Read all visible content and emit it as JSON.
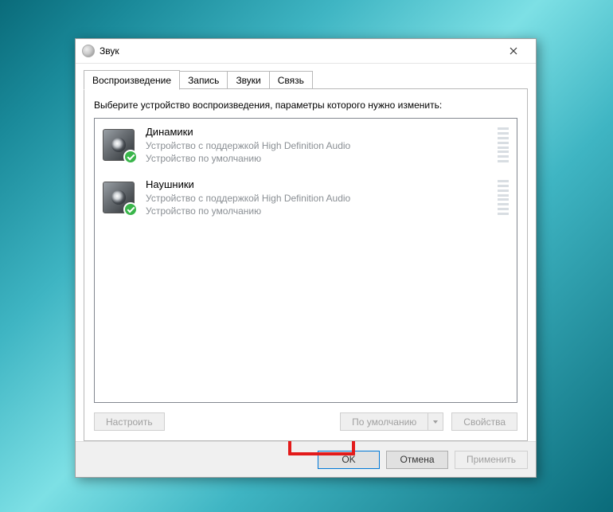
{
  "window": {
    "title": "Звук"
  },
  "tabs": {
    "playback": "Воспроизведение",
    "recording": "Запись",
    "sounds": "Звуки",
    "comm": "Связь"
  },
  "panel": {
    "instruction": "Выберите устройство воспроизведения, параметры которого нужно изменить:"
  },
  "devices": [
    {
      "name": "Динамики",
      "driver": "Устройство с поддержкой High Definition Audio",
      "status": "Устройство по умолчанию"
    },
    {
      "name": "Наушники",
      "driver": "Устройство с поддержкой High Definition Audio",
      "status": "Устройство по умолчанию"
    }
  ],
  "buttons": {
    "configure": "Настроить",
    "set_default": "По умолчанию",
    "properties": "Свойства",
    "ok": "OK",
    "cancel": "Отмена",
    "apply": "Применить"
  },
  "colors": {
    "annotation": "#e31b1b",
    "accent": "#0078d7",
    "check": "#39b54a"
  }
}
